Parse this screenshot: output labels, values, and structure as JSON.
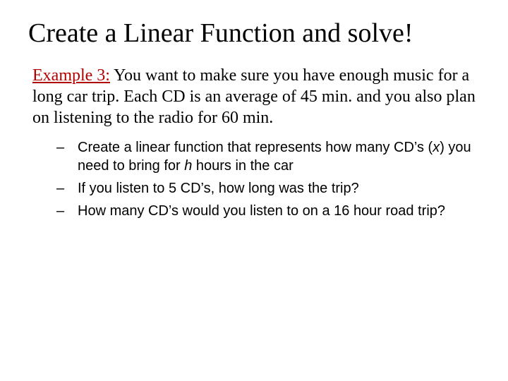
{
  "title": "Create a Linear Function and solve!",
  "example_label": "Example 3:",
  "body_after_label": " You want to make sure you have enough music for a long car trip.  Each CD is an average of 45 min. and you also plan on listening to the radio for 60 min.",
  "bullets": {
    "b1_pre": "Create a linear function that represents how many CD’s (",
    "b1_var1": "x",
    "b1_mid": ") you need to bring for ",
    "b1_var2": "h",
    "b1_post": " hours in the car",
    "b2": "If you listen to 5 CD’s, how long was the trip?",
    "b3": "How many CD’s would you listen to on a 16 hour road trip?"
  }
}
